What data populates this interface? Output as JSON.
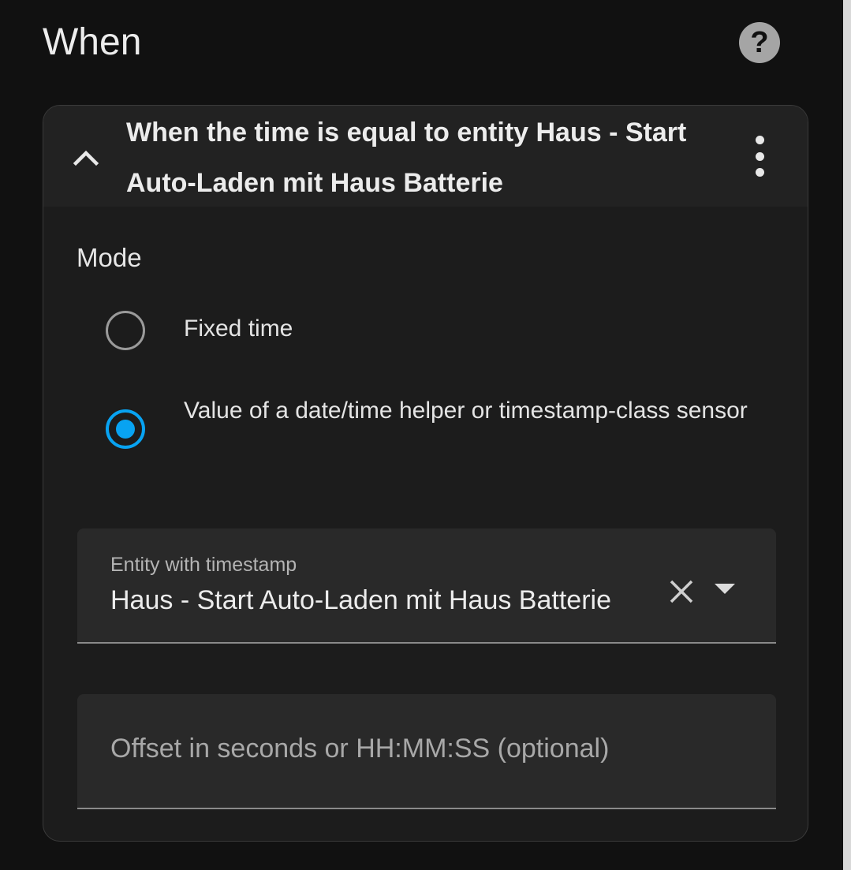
{
  "section": {
    "title": "When",
    "help_icon": "help-circle-icon",
    "help_glyph": "?"
  },
  "trigger_card": {
    "title": "When the time is equal to entity Haus - Start Auto-Laden mit Haus Batterie",
    "expanded": true,
    "collapse_icon": "chevron-up-icon",
    "menu_icon": "more-vertical-icon"
  },
  "mode": {
    "label": "Mode",
    "options": [
      {
        "label": "Fixed time",
        "selected": false
      },
      {
        "label": "Value of a date/time helper or timestamp-class sensor",
        "selected": true
      }
    ]
  },
  "entity_field": {
    "label": "Entity with timestamp",
    "value": "Haus - Start Auto-Laden mit Haus Batterie",
    "clear_icon": "close-icon",
    "dropdown_icon": "caret-down-icon"
  },
  "offset_field": {
    "placeholder": "Offset in seconds or HH:MM:SS (optional)",
    "value": ""
  },
  "colors": {
    "background": "#111111",
    "card": "#1c1c1c",
    "card_header": "#222222",
    "field": "#292929",
    "accent": "#08a3f2",
    "text": "#e1e1e1",
    "muted_text": "#a8a8a8"
  }
}
